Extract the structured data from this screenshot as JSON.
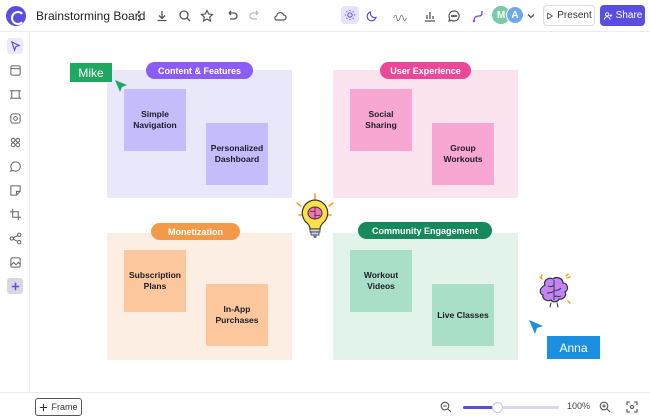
{
  "header": {
    "title": "Brainstorming Board",
    "present_label": "Present",
    "share_label": "Share"
  },
  "collaborators": [
    {
      "initial": "M",
      "color": "#7cc9a8"
    },
    {
      "initial": "A",
      "color": "#6fa8e8"
    }
  ],
  "board": {
    "frames": [
      {
        "title": "Content & Features",
        "pill_color": "#8b5cf6",
        "bg": "#e9e8fb",
        "notes": [
          {
            "text": "Simple Navigation",
            "color": "#c3befb"
          },
          {
            "text": "Personalized Dashboard",
            "color": "#c3befb"
          }
        ]
      },
      {
        "title": "User Experience",
        "pill_color": "#ec4899",
        "bg": "#fbe4ef",
        "notes": [
          {
            "text": "Social Sharing",
            "color": "#f7a7d2"
          },
          {
            "text": "Group Workouts",
            "color": "#f7a7d2"
          }
        ]
      },
      {
        "title": "Monetization",
        "pill_color": "#f2994a",
        "bg": "#fdeee3",
        "notes": [
          {
            "text": "Subscription Plans",
            "color": "#fcc79c"
          },
          {
            "text": "In-App Purchases",
            "color": "#fcc79c"
          }
        ]
      },
      {
        "title": "Community Engagement",
        "pill_color": "#168a5c",
        "bg": "#e2f3ea",
        "notes": [
          {
            "text": "Workout Videos",
            "color": "#a9dfc6"
          },
          {
            "text": "Live Classes",
            "color": "#a9dfc6"
          }
        ]
      }
    ],
    "cursors": [
      {
        "name": "Mike",
        "color": "#1fa85f"
      },
      {
        "name": "Anna",
        "color": "#1c8fe0"
      }
    ]
  },
  "footer": {
    "frame_label": "Frame",
    "zoom_value": "100%",
    "zoom_fraction": 0.35
  },
  "icons": {
    "topbar": [
      "logo-icon",
      "more-vertical-icon",
      "download-icon",
      "search-icon",
      "star-icon",
      "undo-icon",
      "redo-icon",
      "cloud-icon",
      "sun-icon",
      "moon-icon",
      "animation-icon",
      "chart-icon",
      "comment-icon",
      "connector-icon",
      "chevron-down-icon",
      "play-icon",
      "share-user-icon"
    ],
    "sidebar": [
      "select-icon",
      "frame-icon",
      "resize-icon",
      "shape-icon",
      "components-icon",
      "comment-icon",
      "sticky-note-icon",
      "crop-icon",
      "mindmap-icon",
      "image-icon",
      "add-icon"
    ]
  }
}
